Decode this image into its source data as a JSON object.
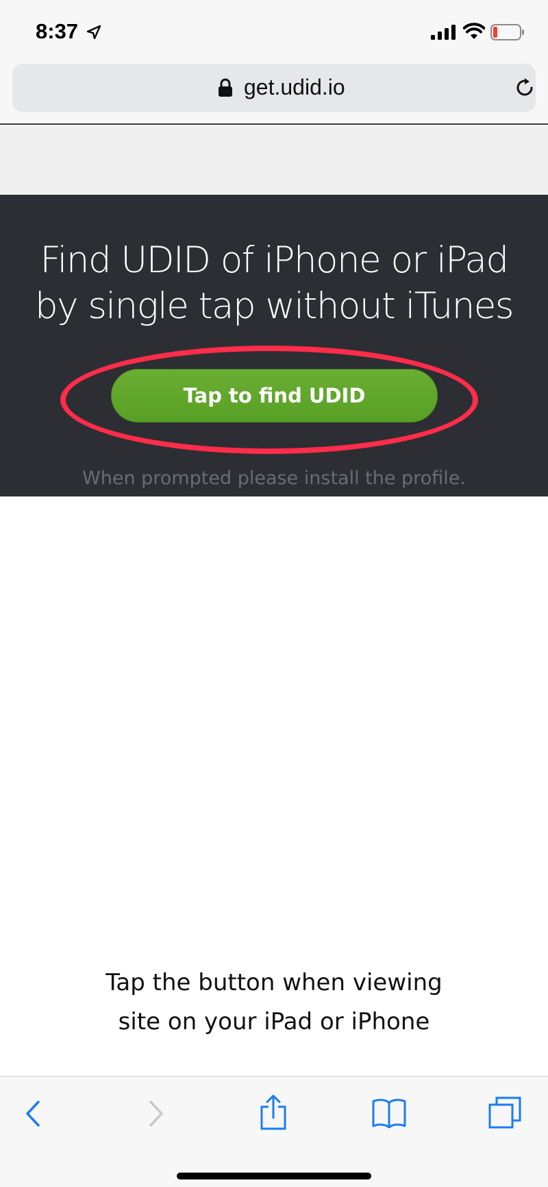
{
  "status_bar": {
    "time": "8:37"
  },
  "browser": {
    "url": "get.udid.io"
  },
  "hero": {
    "title_line1": "Find UDID of iPhone or iPad",
    "title_line2": "by single tap without iTunes",
    "button_label": "Tap to find UDID",
    "note": "When prompted please install the profile."
  },
  "desktop_note": {
    "line1": "Tap the button when viewing",
    "line2": "site on your iPad or iPhone"
  },
  "toolbar": {
    "items": [
      "back-icon",
      "forward-icon",
      "share-icon",
      "bookmarks-icon",
      "tabs-icon"
    ]
  },
  "colors": {
    "hero_background": "#2c2e33",
    "button_green": "#5ea32a",
    "highlight_red": "#ff2c4a",
    "ios_blue": "#1a7cf5"
  }
}
